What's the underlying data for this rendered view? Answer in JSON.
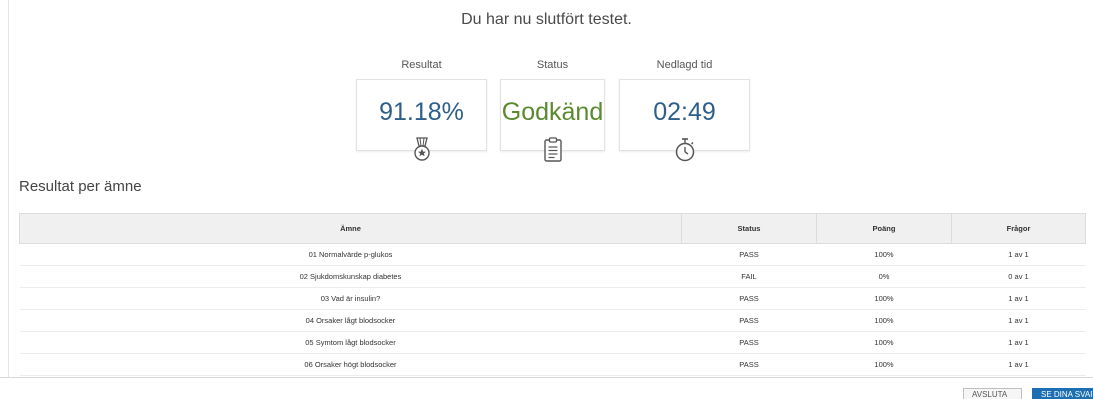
{
  "headline": "Du har nu slutfört testet.",
  "cards": [
    {
      "label": "Resultat",
      "value": "91.18%",
      "icon": "medal-icon",
      "color": "#2d5f8a"
    },
    {
      "label": "Status",
      "value": "Godkänd",
      "icon": "clipboard-icon",
      "color": "#5a8a2e"
    },
    {
      "label": "Nedlagd tid",
      "value": "02:49",
      "icon": "stopwatch-icon",
      "color": "#2d5f8a"
    }
  ],
  "section_title": "Resultat per ämne",
  "table": {
    "headers": [
      "Ämne",
      "Status",
      "Poäng",
      "Frågor"
    ],
    "rows": [
      [
        "01 Normalvärde p-glukos",
        "PASS",
        "100%",
        "1 av 1"
      ],
      [
        "02 Sjukdomskunskap diabetes",
        "FAIL",
        "0%",
        "0 av 1"
      ],
      [
        "03 Vad är insulin?",
        "PASS",
        "100%",
        "1 av 1"
      ],
      [
        "04 Orsaker lågt blodsocker",
        "PASS",
        "100%",
        "1 av 1"
      ],
      [
        "05 Symtom lågt blodsocker",
        "PASS",
        "100%",
        "1 av 1"
      ],
      [
        "06 Orsaker högt blodsocker",
        "PASS",
        "100%",
        "1 av 1"
      ]
    ]
  },
  "buttons": {
    "finish_label": "AVSLUTA",
    "answers_label": "SE DINA SVAR"
  }
}
